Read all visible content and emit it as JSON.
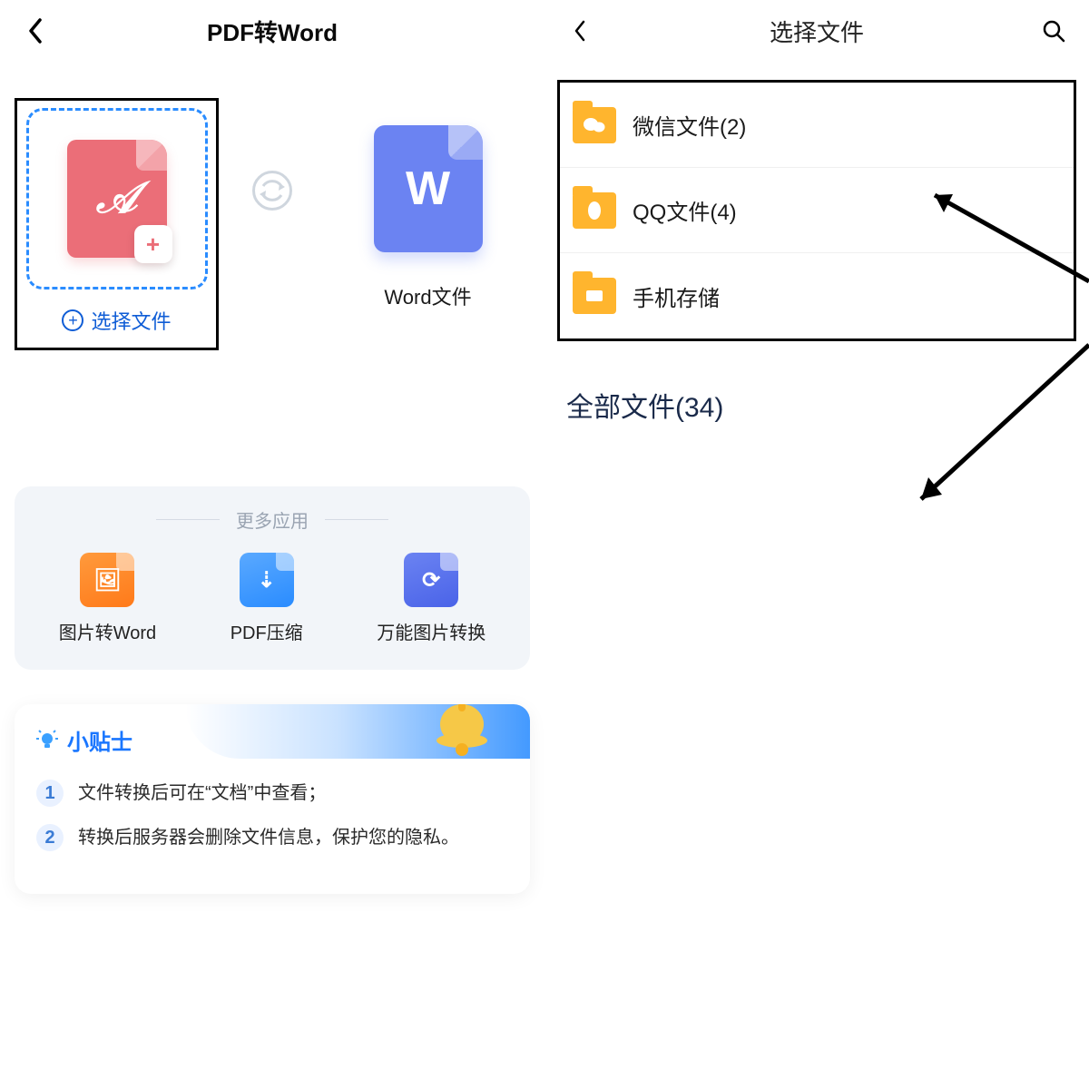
{
  "left": {
    "title": "PDF转Word",
    "select_file": "选择文件",
    "word_label": "Word文件",
    "more_apps_title": "更多应用",
    "apps": [
      {
        "label": "图片转Word"
      },
      {
        "label": "PDF压缩"
      },
      {
        "label": "万能图片转换"
      }
    ],
    "tips_title": "小贴士",
    "tips": [
      "文件转换后可在“文档”中查看；",
      "转换后服务器会删除文件信息，保护您的隐私。"
    ]
  },
  "right": {
    "title": "选择文件",
    "folders": [
      {
        "label": "微信文件(2)"
      },
      {
        "label": "QQ文件(4)"
      },
      {
        "label": "手机存储"
      }
    ],
    "all_files": "全部文件(34)"
  },
  "colors": {
    "accent_blue": "#2a8cff",
    "link_blue": "#0f5dd6",
    "pdf_red": "#eb6e78",
    "word_blue": "#6b83f2",
    "folder_yellow": "#ffb52e"
  }
}
